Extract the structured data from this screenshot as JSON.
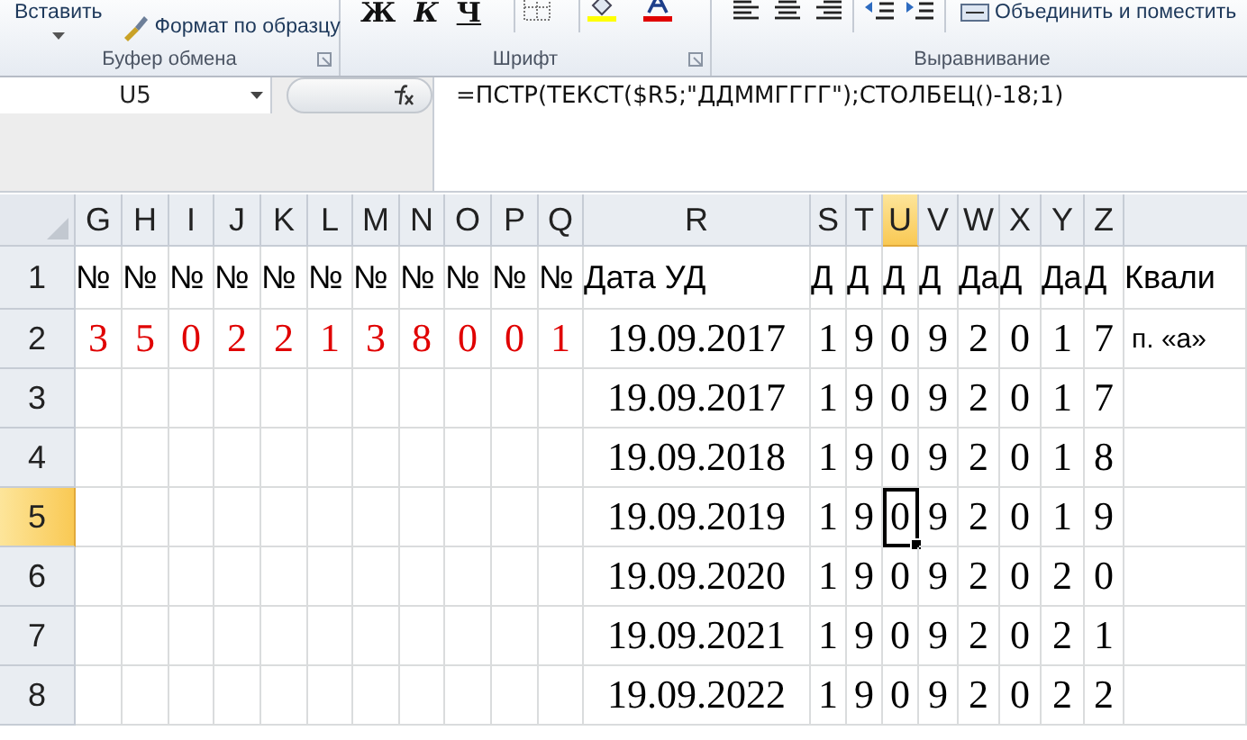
{
  "ribbon": {
    "groups": [
      {
        "label": "Буфер обмена",
        "kind": "clipboard",
        "paste": "Вставить",
        "format_painter": "Формат по образцу"
      },
      {
        "label": "Шрифт",
        "kind": "font",
        "bold": "Ж",
        "italic": "К",
        "underline": "Ч"
      },
      {
        "label": "Выравнивание",
        "kind": "alignment",
        "merge": "Объединить и поместить"
      }
    ]
  },
  "formula_bar": {
    "name_box": "U5",
    "formula": "=ПСТР(ТЕКСТ($R5;\"ДДММГГГГ\");СТОЛБЕЦ()-18;1)"
  },
  "columns": [
    {
      "label": "G",
      "selected": false
    },
    {
      "label": "H",
      "selected": false
    },
    {
      "label": "I",
      "selected": false
    },
    {
      "label": "J",
      "selected": false
    },
    {
      "label": "K",
      "selected": false
    },
    {
      "label": "L",
      "selected": false
    },
    {
      "label": "M",
      "selected": false
    },
    {
      "label": "N",
      "selected": false
    },
    {
      "label": "O",
      "selected": false
    },
    {
      "label": "P",
      "selected": false
    },
    {
      "label": "Q",
      "selected": false
    },
    {
      "label": "R",
      "selected": false
    },
    {
      "label": "S",
      "selected": false
    },
    {
      "label": "T",
      "selected": false
    },
    {
      "label": "U",
      "selected": true
    },
    {
      "label": "V",
      "selected": false
    },
    {
      "label": "W",
      "selected": false
    },
    {
      "label": "X",
      "selected": false
    },
    {
      "label": "Y",
      "selected": false
    },
    {
      "label": "Z",
      "selected": false
    }
  ],
  "rows": [
    {
      "label": "1",
      "selected": false,
      "kind": "header",
      "cells": [
        "№",
        "№",
        "№",
        "№",
        "№",
        "№",
        "№",
        "№",
        "№",
        "№",
        "№",
        "Дата УД",
        "Д",
        "Д",
        "Д",
        "Д",
        "Да",
        "Д",
        "Да",
        "Д",
        "Квали"
      ]
    },
    {
      "label": "2",
      "selected": false,
      "kind": "data",
      "color": "#e00000",
      "cells": [
        "3",
        "5",
        "0",
        "2",
        "2",
        "1",
        "3",
        "8",
        "0",
        "0",
        "1",
        "19.09.2017",
        "1",
        "9",
        "0",
        "9",
        "2",
        "0",
        "1",
        "7",
        "п. «а»"
      ]
    },
    {
      "label": "3",
      "selected": false,
      "kind": "data",
      "cells": [
        null,
        null,
        null,
        null,
        null,
        null,
        null,
        null,
        null,
        null,
        null,
        "19.09.2017",
        "1",
        "9",
        "0",
        "9",
        "2",
        "0",
        "1",
        "7",
        null
      ]
    },
    {
      "label": "4",
      "selected": false,
      "kind": "data",
      "cells": [
        null,
        null,
        null,
        null,
        null,
        null,
        null,
        null,
        null,
        null,
        null,
        "19.09.2018",
        "1",
        "9",
        "0",
        "9",
        "2",
        "0",
        "1",
        "8",
        null
      ]
    },
    {
      "label": "5",
      "selected": true,
      "kind": "data",
      "cells": [
        null,
        null,
        null,
        null,
        null,
        null,
        null,
        null,
        null,
        null,
        null,
        "19.09.2019",
        "1",
        "9",
        "0",
        "9",
        "2",
        "0",
        "1",
        "9",
        null
      ]
    },
    {
      "label": "6",
      "selected": false,
      "kind": "data",
      "cells": [
        null,
        null,
        null,
        null,
        null,
        null,
        null,
        null,
        null,
        null,
        null,
        "19.09.2020",
        "1",
        "9",
        "0",
        "9",
        "2",
        "0",
        "2",
        "0",
        null
      ]
    },
    {
      "label": "7",
      "selected": false,
      "kind": "data",
      "cells": [
        null,
        null,
        null,
        null,
        null,
        null,
        null,
        null,
        null,
        null,
        null,
        "19.09.2021",
        "1",
        "9",
        "0",
        "9",
        "2",
        "0",
        "2",
        "1",
        null
      ]
    },
    {
      "label": "8",
      "selected": false,
      "kind": "data",
      "cells": [
        null,
        null,
        null,
        null,
        null,
        null,
        null,
        null,
        null,
        null,
        null,
        "19.09.2022",
        "1",
        "9",
        "0",
        "9",
        "2",
        "0",
        "2",
        "2",
        null
      ]
    }
  ]
}
